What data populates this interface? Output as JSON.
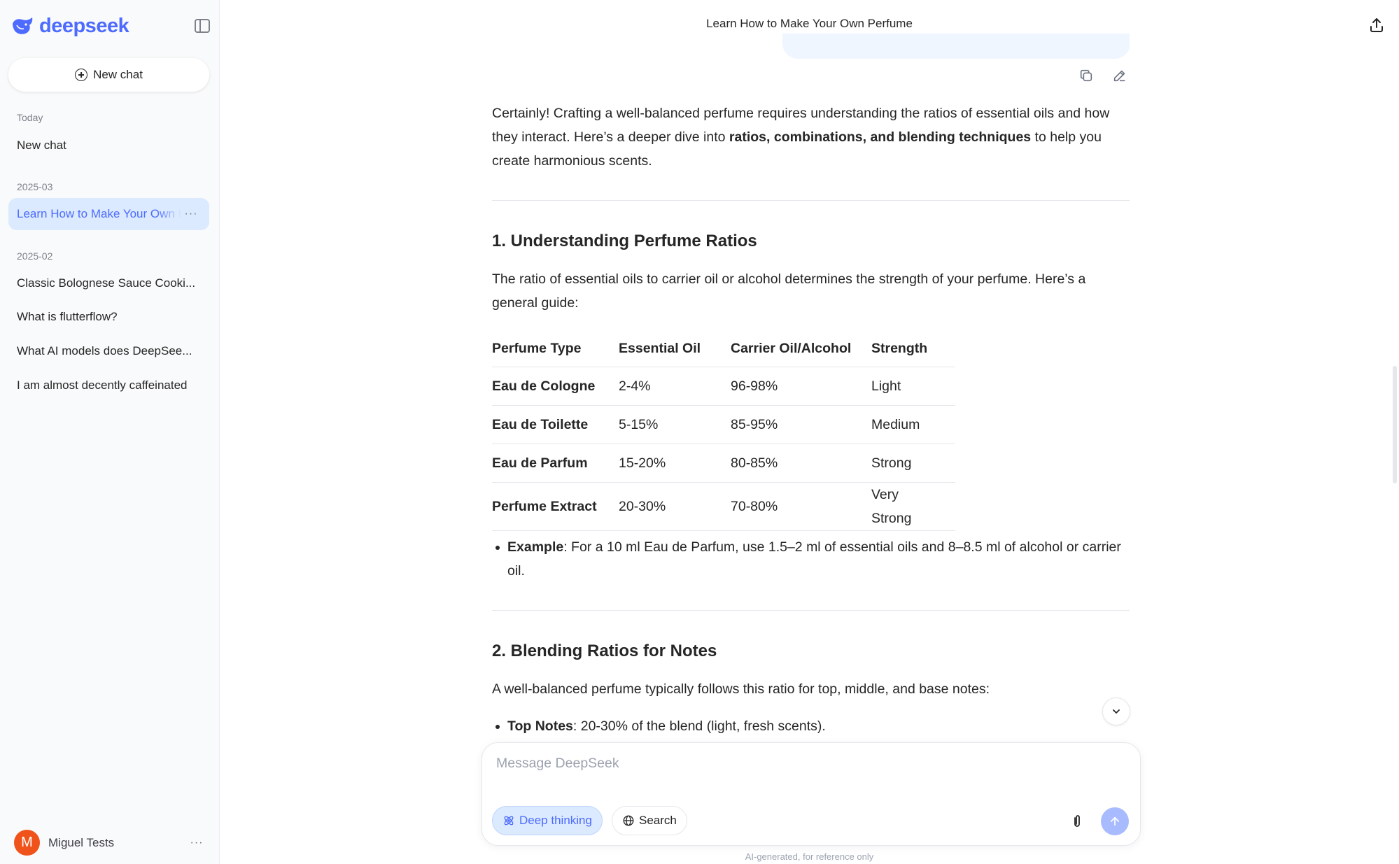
{
  "sidebar": {
    "logo_text": "deepseek",
    "new_chat_label": "New chat",
    "groups": [
      {
        "label": "Today",
        "items": [
          {
            "label": "New chat"
          }
        ]
      },
      {
        "label": "2025-03",
        "items": [
          {
            "label": "Learn How to Make Your Own Perfume"
          }
        ]
      },
      {
        "label": "2025-02",
        "items": [
          {
            "label": "Classic Bolognese Sauce Cooki..."
          },
          {
            "label": "What is flutterflow?"
          },
          {
            "label": "What AI models does DeepSee..."
          },
          {
            "label": "I am almost decently caffeinated"
          }
        ]
      }
    ],
    "more_label": "···",
    "user": {
      "initial": "M",
      "name": "Miguel Tests",
      "avatar_color": "#f0521c"
    }
  },
  "header": {
    "title": "Learn How to Make Your Own Perfume"
  },
  "message": {
    "intro_a": "Certainly! Crafting a well-balanced perfume requires understanding the ratios of essential oils and how they interact. Here’s a deeper dive into ",
    "intro_bold": "ratios, combinations, and blending techniques",
    "intro_b": " to help you create harmonious scents.",
    "section1": {
      "title": "1. Understanding Perfume Ratios",
      "body": "The ratio of essential oils to carrier oil or alcohol determines the strength of your perfume. Here’s a general guide:",
      "table": {
        "headers": [
          "Perfume Type",
          "Essential Oil",
          "Carrier Oil/Alcohol",
          "Strength"
        ],
        "rows": [
          [
            "Eau de Cologne",
            "2-4%",
            "96-98%",
            "Light"
          ],
          [
            "Eau de Toilette",
            "5-15%",
            "85-95%",
            "Medium"
          ],
          [
            "Eau de Parfum",
            "15-20%",
            "80-85%",
            "Strong"
          ],
          [
            "Perfume Extract",
            "20-30%",
            "70-80%",
            "Very Strong"
          ]
        ]
      },
      "example_label": "Example",
      "example_text": ": For a 10 ml Eau de Parfum, use 1.5–2 ml of essential oils and 8–8.5 ml of alcohol or carrier oil."
    },
    "section2": {
      "title": "2. Blending Ratios for Notes",
      "body": "A well-balanced perfume typically follows this ratio for top, middle, and base notes:",
      "bullet_label": "Top Notes",
      "bullet_text": ": 20-30% of the blend (light, fresh scents)."
    }
  },
  "composer": {
    "placeholder": "Message DeepSeek",
    "deep_thinking_label": "Deep thinking",
    "search_label": "Search"
  },
  "footer": {
    "disclaimer": "AI-generated, for reference only"
  },
  "colors": {
    "accent": "#4d6bfe",
    "active_bg": "#dbeafe",
    "send_disabled": "#a8bbff"
  }
}
